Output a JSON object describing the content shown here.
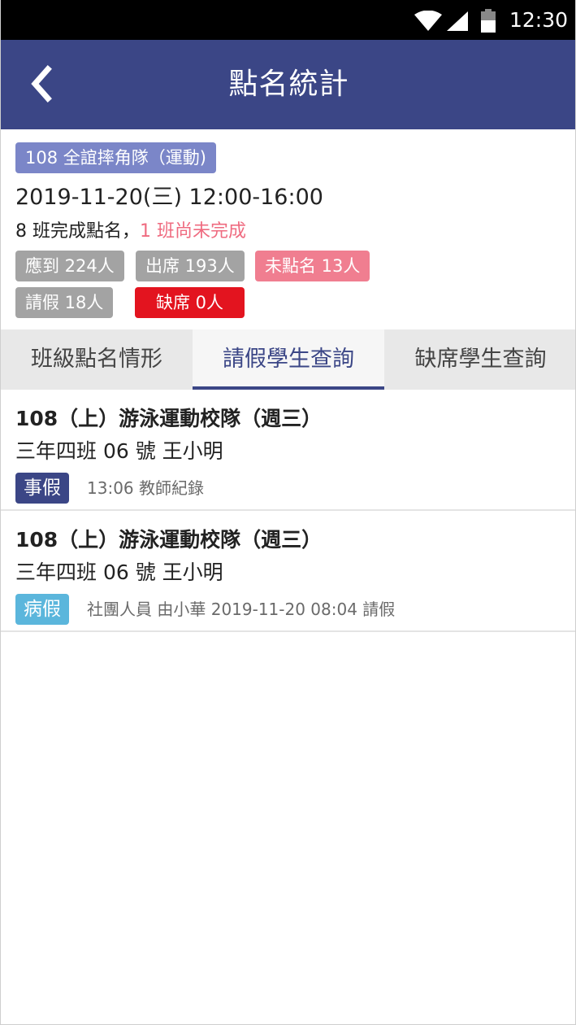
{
  "status_bar": {
    "time": "12:30",
    "icons": [
      "wifi-icon",
      "cell-signal-icon",
      "battery-icon"
    ]
  },
  "app_bar": {
    "back_icon": "chevron-left-icon",
    "title": "點名統計"
  },
  "summary": {
    "team_badge": "108 全誼摔角隊（運動)",
    "datetime": "2019-11-20(三) 12:00-16:00",
    "completed_text": "8 班完成點名，",
    "pending_text": "1 班尚未完成",
    "stats": {
      "expected": "應到 224人",
      "present": "出席 193人",
      "not_called": "未點名 13人",
      "leave": "請假 18人",
      "absent": "缺席 0人"
    }
  },
  "tabs": [
    {
      "label": "班級點名情形",
      "active": false
    },
    {
      "label": "請假學生查詢",
      "active": true
    },
    {
      "label": "缺席學生查詢",
      "active": false
    }
  ],
  "records": [
    {
      "course": "108（上）游泳運動校隊（週三）",
      "student": "三年四班 06 號 王小明",
      "leave_type": "事假",
      "note": "13:06 教師紀錄"
    },
    {
      "course": "108（上）游泳運動校隊（週三）",
      "student": "三年四班 06 號 王小明",
      "leave_type": "病假",
      "note": "社團人員 由小華 2019-11-20 08:04 請假"
    }
  ],
  "colors": {
    "primary": "#3b4686",
    "badge": "#7b86c8",
    "pending_text": "#ef6b80",
    "chip_gray": "#a3a3a3",
    "chip_pink": "#f07e90",
    "chip_red": "#e3141f",
    "sick_leave": "#5bb6dc"
  }
}
